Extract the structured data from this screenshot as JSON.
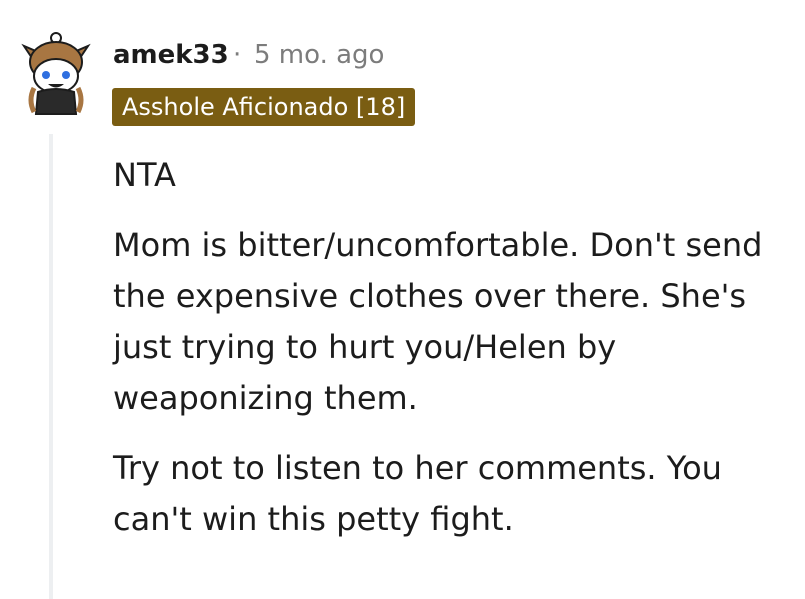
{
  "comment": {
    "author": "amek33",
    "separator": "·",
    "timestamp": "5 mo. ago",
    "flair": "Asshole Aficionado [18]",
    "avatar_icon": "snoo-owl-avatar-icon",
    "paragraphs": [
      "NTA",
      "Mom is bitter/uncomfortable. Don't send\nthe expensive clothes over there. She's\njust trying to hurt you/Helen by\nweaponizing them.",
      "Try not to listen to her comments. You\ncan't win this petty fight."
    ]
  },
  "colors": {
    "flair_bg": "#7a5d12",
    "thread_line": "#edeff1",
    "meta_text": "#7c7c7c"
  }
}
